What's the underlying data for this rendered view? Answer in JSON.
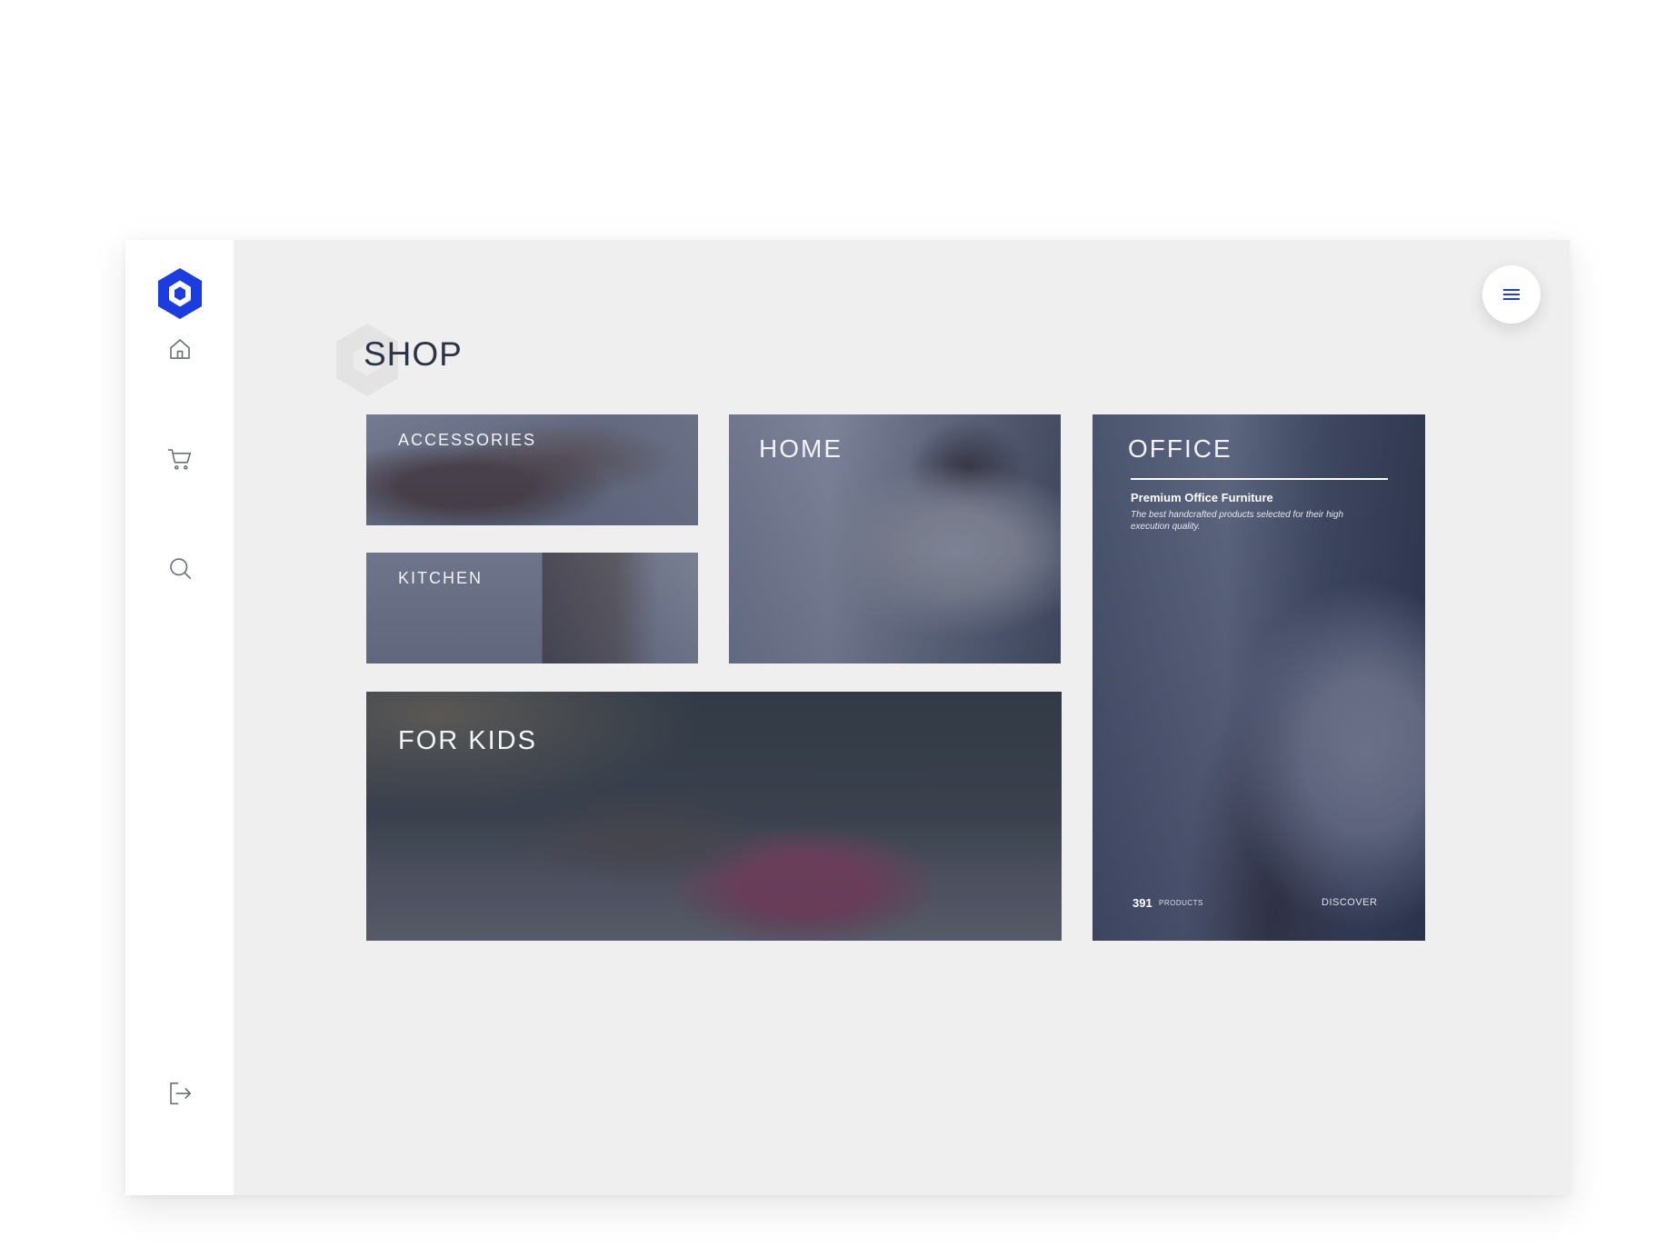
{
  "brand": {
    "accent": "#1a3ce0",
    "logo_icon": "hexagon-logo-icon"
  },
  "sidebar": {
    "items": [
      {
        "icon": "home-icon"
      },
      {
        "icon": "cart-icon"
      },
      {
        "icon": "search-icon"
      }
    ],
    "logout_icon": "logout-icon"
  },
  "header": {
    "menu_icon": "hamburger-menu-icon"
  },
  "page": {
    "title": "SHOP"
  },
  "categories": {
    "accessories": {
      "label": "ACCESSORIES"
    },
    "kitchen": {
      "label": "KITCHEN"
    },
    "home": {
      "label": "HOME"
    },
    "kids": {
      "label": "FOR KIDS"
    },
    "office": {
      "label": "OFFICE",
      "subtitle": "Premium Office Furniture",
      "description": "The best handcrafted products selected for their high execution quality.",
      "count": "391",
      "count_label": "PRODUCTS",
      "cta": "DISCOVER"
    }
  }
}
